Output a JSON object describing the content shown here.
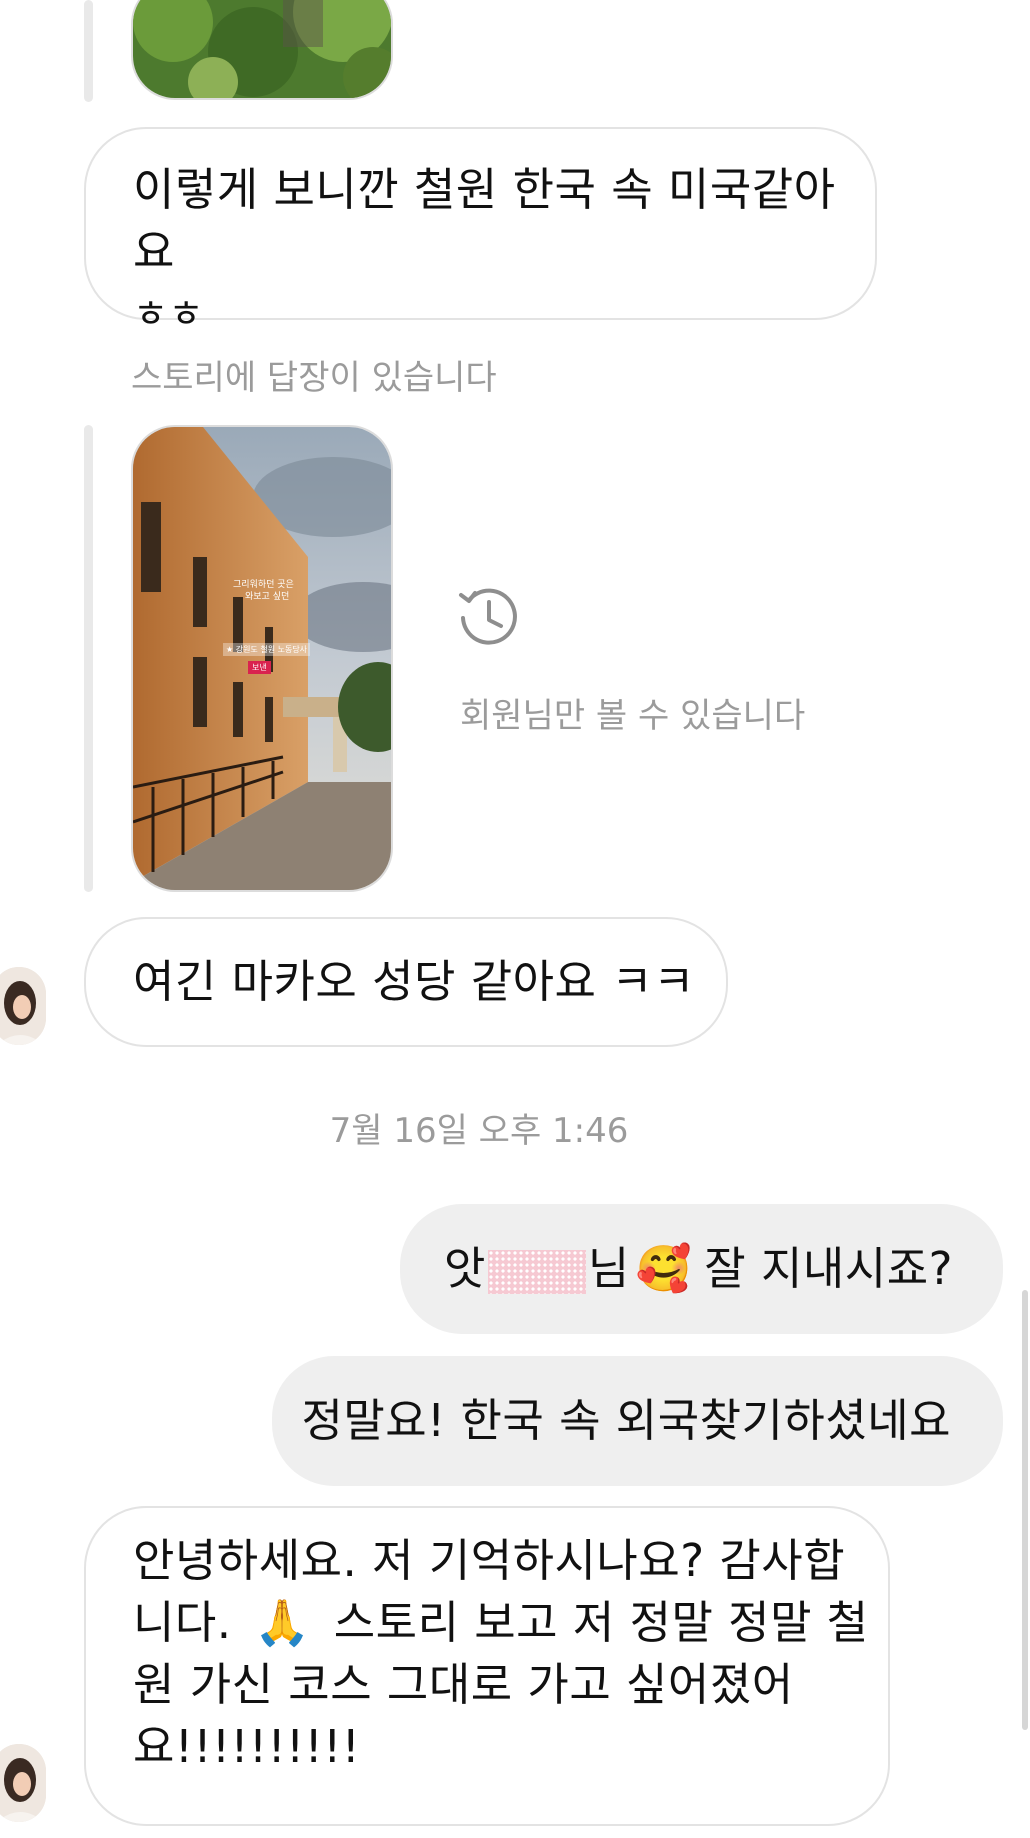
{
  "messages": {
    "msg1": "이렇게 보니깐 철원 한국 속 미국같아요",
    "msg1_line2": "ㅎㅎ",
    "story_reply_label": "스토리에 답장이 있습니다",
    "story_overlay_text1": "그리워하던 곳은",
    "story_overlay_text2": "와보고 싶던",
    "story_sticker_text": "★ 강원도 철원 노동당사",
    "story_sticker_badge": "보낸",
    "restricted_text": "회원님만 볼 수 있습니다",
    "msg2": "여긴 마카오 성당 같아요 ㅋㅋ",
    "timestamp": "7월 16일 오후 1:46",
    "out1_prefix": "앗",
    "out1_suffix": "님",
    "out1_emoji": "🥰",
    "out1_tail": "잘 지내시죠?",
    "out2": "정말요! 한국 속 외국찾기하셨네요",
    "msg3_line1": "안녕하세요. 저 기억하시나요? 감사합",
    "msg3_line2_a": "니다.",
    "msg3_emoji": "🙏",
    "msg3_line2_b": "스토리 보고 저 정말 정말 철",
    "msg3_line3": "원 가신 코스 그대로 가고 싶어졌어",
    "msg3_line4": "요!!!!!!!!!!"
  },
  "icons": {
    "history": "history-clock-icon",
    "avatar": "user-avatar-icon"
  },
  "colors": {
    "bubble_out_bg": "#efefef",
    "bubble_in_border": "#e3e3e3",
    "meta_text": "#9b9b9b",
    "redaction": "#f6c9d2"
  }
}
